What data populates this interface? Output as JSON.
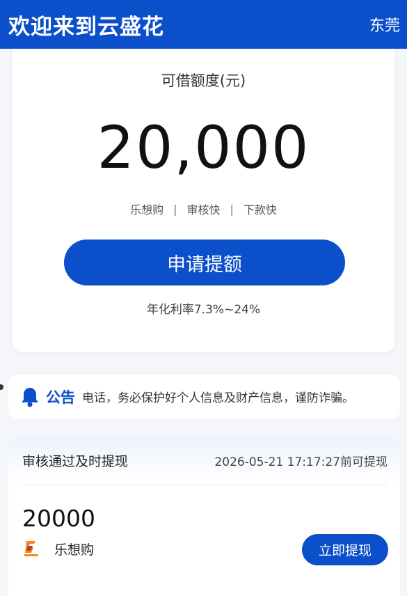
{
  "header": {
    "title": "欢迎来到云盛花",
    "city": "东莞"
  },
  "quota": {
    "label": "可借额度(元)",
    "amount": "20,000",
    "features": [
      "乐想购",
      "审核快",
      "下款快"
    ],
    "separator": "|",
    "apply_label": "申请提额",
    "rate": "年化利率7.3%~24%"
  },
  "notice": {
    "icon": "bell-icon",
    "title": "公告",
    "text": "电话，务必保护好个人信息及财产信息，谨防诈骗。"
  },
  "withdraw": {
    "title": "审核通过及时提现",
    "time": "2026-05-21 17:17:27前可提现",
    "amount": "20000",
    "brand_name": "乐想购",
    "button_label": "立即提现"
  },
  "colors": {
    "brand": "#0b4fcb",
    "background": "#f4f6f9"
  }
}
